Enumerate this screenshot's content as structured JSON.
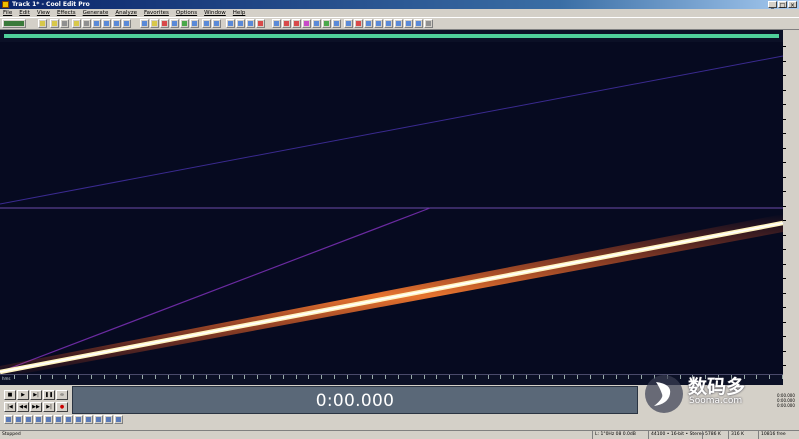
{
  "window": {
    "title": "Track 1* - Cool Edit Pro",
    "minimize": "_",
    "maximize": "□",
    "close": "×"
  },
  "menu": [
    "File",
    "Edit",
    "View",
    "Effects",
    "Generate",
    "Analyze",
    "Favorites",
    "Options",
    "Window",
    "Help"
  ],
  "toolbar": {
    "button_colors": [
      "#3a7a3a",
      "#d8c84a",
      "#d8c84a",
      "#909090",
      "#d8c84a",
      "#909090",
      "#5a8ad8",
      "#5a8ad8",
      "#5a8ad8",
      "#5a8ad8",
      "#5a8ad8",
      "#d8c84a",
      "#d84a4a",
      "#5a8ad8",
      "#4aa84a",
      "#5a8ad8",
      "#5a8ad8",
      "#5a8ad8",
      "#5a8ad8",
      "#5a8ad8",
      "#5a8ad8",
      "#d84a4a",
      "#5a8ad8",
      "#d84a4a",
      "#d84a4a",
      "#c84ac8",
      "#5a8ad8",
      "#4aa84a",
      "#5a8ad8",
      "#5a8ad8",
      "#d84a4a",
      "#5a8ad8",
      "#5a8ad8",
      "#5a8ad8",
      "#5a8ad8",
      "#5a8ad8",
      "#5a8ad8",
      "#909090"
    ]
  },
  "overview": {
    "bar_color": "#4fcf9a"
  },
  "spectral": {
    "background": "#060a20",
    "channel_divider_color": "#6a4aa8",
    "top_channel": {
      "sweep_color": "#3a2a90",
      "level": 0
    },
    "bottom_channel": {
      "sweep_color": "#fff4c0",
      "glow_color": "#ff8030",
      "harmonic_color": "#6a2aa0"
    }
  },
  "time_display": {
    "value": "0:00.000"
  },
  "selection": {
    "begin": "0:00.000",
    "end": "0:00.000",
    "length": "0:00.000"
  },
  "status": {
    "state": "Stopped",
    "cells": [
      "L: 1°0Hz 08  0.0dB",
      "44100 • 16-bit • Stereo",
      "5786 K",
      "316 K",
      "10816 free"
    ]
  },
  "watermark": {
    "brand": "数码多",
    "url": "Sooma.com"
  }
}
